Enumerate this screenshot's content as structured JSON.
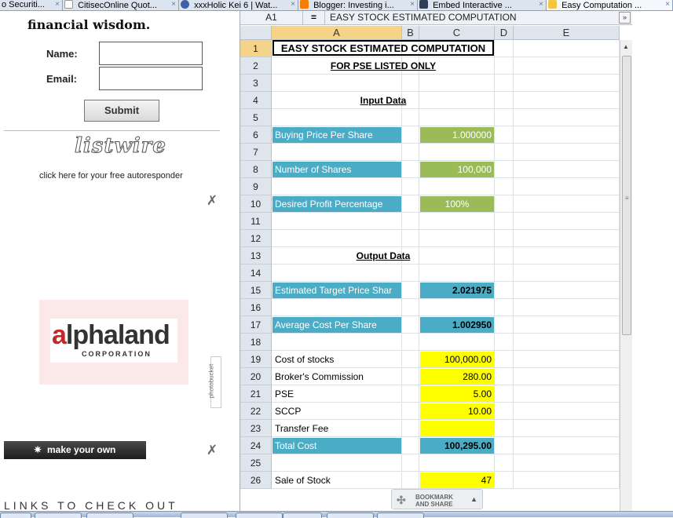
{
  "browser": {
    "tabs": [
      {
        "label": "o Securiti...",
        "active": false
      },
      {
        "label": "CitisecOnline Quot...",
        "active": false
      },
      {
        "label": "xxxHolic Kei 6 | Wat...",
        "active": false
      },
      {
        "label": "Blogger: Investing i...",
        "active": false
      },
      {
        "label": "Embed Interactive ...",
        "active": false
      },
      {
        "label": "Easy Computation ...",
        "active": true
      }
    ],
    "close_glyph": "×"
  },
  "left": {
    "heading": "financial wisdom.",
    "name_label": "Name:",
    "email_label": "Email:",
    "name_value": "",
    "email_value": "",
    "submit_label": "Submit",
    "listwire_logo": "listwire",
    "autoresponder_text": "click here for your free autoresponder",
    "ad_brand": "alphaland",
    "ad_sub": "CORPORATION",
    "photobucket": "photobucket",
    "make_own_label": "make your own",
    "links_heading": "LINKS TO CHECK OUT",
    "tool_icon": "wrench-screwdriver-icon"
  },
  "sheet": {
    "cell_ref": "A1",
    "equals": "=",
    "formula": "EASY STOCK ESTIMATED COMPUTATION",
    "expand_glyph": "»",
    "columns": [
      "A",
      "B",
      "C",
      "D",
      "E"
    ],
    "rows": [
      "1",
      "2",
      "3",
      "4",
      "5",
      "6",
      "7",
      "8",
      "9",
      "10",
      "11",
      "12",
      "13",
      "14",
      "15",
      "16",
      "17",
      "18",
      "19",
      "20",
      "21",
      "22",
      "23",
      "24",
      "25",
      "26"
    ],
    "cells": {
      "r1_title": "EASY STOCK ESTIMATED COMPUTATION",
      "r2_sub": "FOR PSE LISTED ONLY",
      "r4_input": "Input Data",
      "r6_label": "Buying Price Per Share",
      "r6_value": "1.000000",
      "r8_label": "Number of Shares",
      "r8_value": "100,000",
      "r10_label": "Desired Profit Percentage",
      "r10_value": "100%",
      "r13_output": "Output Data",
      "r15_label": "Estimated Target Price Shar",
      "r15_value": "2.021975",
      "r17_label": "Average Cost Per Share",
      "r17_value": "1.002950",
      "r19_label": "Cost of stocks",
      "r19_value": "100,000.00",
      "r20_label": "Broker's Commission",
      "r20_value": "280.00",
      "r21_label": "PSE",
      "r21_value": "5.00",
      "r22_label": "SCCP",
      "r22_value": "10.00",
      "r23_label": "Transfer Fee",
      "r23_value": "",
      "r24_label": "Total Cost",
      "r24_value": "100,295.00",
      "r26_label": "Sale of Stock",
      "r26_value": "47"
    },
    "bookmark_line1": "BOOKMARK",
    "bookmark_line2": "AND SHARE",
    "bookmark_arrow": "▲"
  },
  "colors": {
    "blue": "#4bacc6",
    "green": "#9bbb59",
    "yellow": "#ffff00",
    "selected_header": "#f5d48a"
  }
}
